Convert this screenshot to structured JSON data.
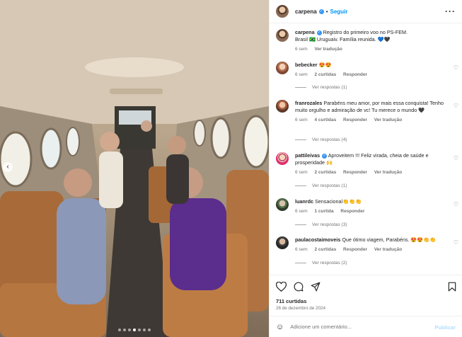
{
  "post": {
    "author": "carpena",
    "follow_label": "Seguir",
    "separator": "•",
    "more_icon": "more-horizontal-icon",
    "caption_line1": "Registro do primeiro voo no PS-FEM.",
    "caption_line2": "Brasil 🇧🇷 Uruguaiv. Família reunida. 💙🖤",
    "caption_time": "6 sem",
    "caption_translate": "Ver tradução",
    "carousel_dots": 7,
    "carousel_active_dot": 3
  },
  "comments": [
    {
      "user": "bebecker",
      "text": "😍😍",
      "time": "6 sem",
      "likes": "2 curtidas",
      "reply": "Responder",
      "translate": "",
      "view_replies": "Ver respostas (1)"
    },
    {
      "user": "franrozales",
      "text": "Parabéns meu amor, por mais essa conquista! Tenho muito orgulho e admiração de vc! Tu merece o mundo 🖤",
      "time": "6 sem",
      "likes": "4 curtidas",
      "reply": "Responder",
      "translate": "Ver tradução",
      "view_replies": "Ver respostas (4)"
    },
    {
      "user": "pattileivas",
      "text": "Aproveitem !!! Feliz virada, cheia de saúde e prosperidade 🙌",
      "time": "6 sem",
      "likes": "2 curtidas",
      "reply": "Responder",
      "translate": "Ver tradução",
      "view_replies": "Ver respostas (1)"
    },
    {
      "user": "luanrdc",
      "text": "Sensacional👏👏👏",
      "time": "6 sem",
      "likes": "1 curtida",
      "reply": "Responder",
      "translate": "",
      "view_replies": "Ver respostas (3)"
    },
    {
      "user": "paulacostaimoveis",
      "text": "Que ótimo viagem, Parabéns. 😍😍👏👏",
      "time": "6 sem",
      "likes": "2 curtidas",
      "reply": "Responder",
      "translate": "Ver tradução",
      "view_replies": "Ver respostas (2)"
    }
  ],
  "footer": {
    "likes": "711 curtidas",
    "date": "26 de dezembro de 2024",
    "add_comment_placeholder": "Adicione um comentário...",
    "publish_label": "Publicar"
  },
  "colors": {
    "link": "#0095f6",
    "verified": "#3897f0",
    "muted": "#737373"
  }
}
